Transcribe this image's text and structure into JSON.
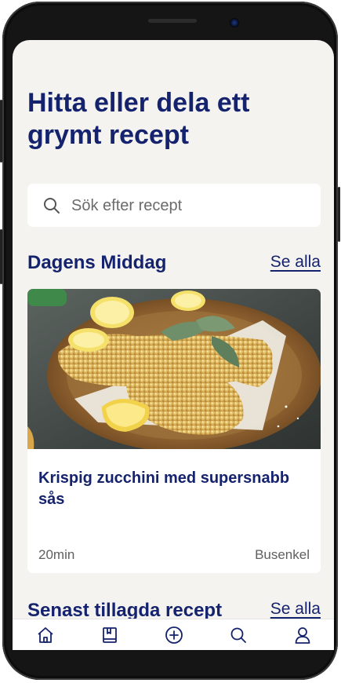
{
  "header": {
    "title": "Hitta eller dela ett grymt recept"
  },
  "search": {
    "placeholder": "Sök efter recept"
  },
  "sections": {
    "dinner": {
      "title": "Dagens Middag",
      "see_all": "Se alla"
    },
    "recent": {
      "title": "Senast tillagda recept",
      "see_all": "Se alla"
    }
  },
  "recipe_card": {
    "title": "Krispig zucchini med supersnabb sås",
    "time": "20min",
    "difficulty": "Busenkel",
    "image": "fried-zucchini-on-plate"
  },
  "bottom_nav": {
    "items": [
      {
        "icon": "home-icon"
      },
      {
        "icon": "book-icon"
      },
      {
        "icon": "add-circle-icon"
      },
      {
        "icon": "search-icon"
      },
      {
        "icon": "profile-icon"
      }
    ]
  },
  "colors": {
    "primary": "#15236e",
    "background": "#f4f3ef",
    "card": "#ffffff",
    "muted_text": "#5f5f5f"
  }
}
